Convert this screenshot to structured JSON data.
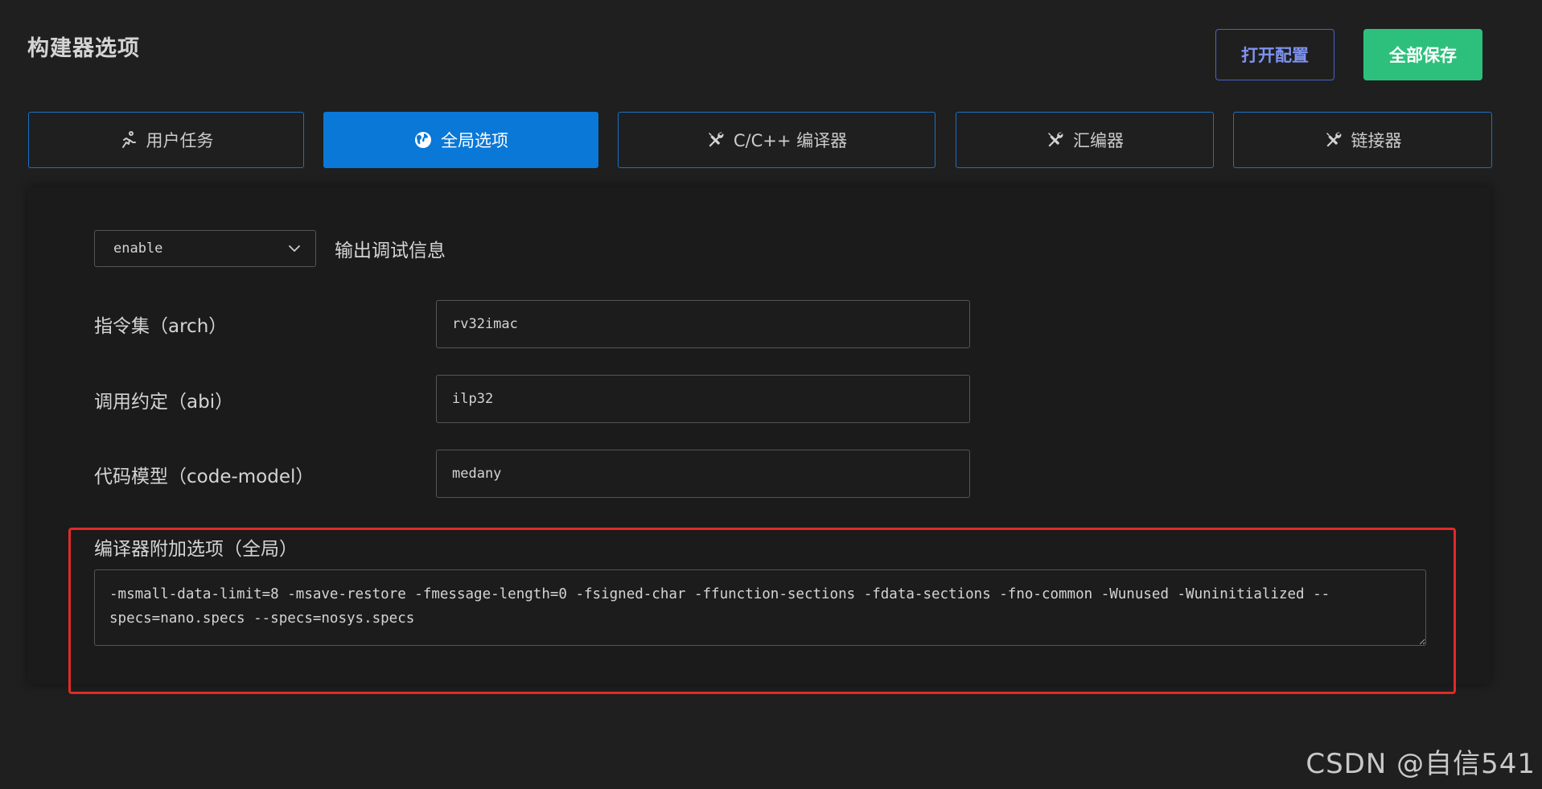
{
  "header": {
    "title": "构建器选项",
    "open_config_label": "打开配置",
    "save_all_label": "全部保存"
  },
  "tabs": [
    {
      "label": "用户任务",
      "icon": "run-icon",
      "active": false
    },
    {
      "label": "全局选项",
      "icon": "globe-icon",
      "active": true
    },
    {
      "label": "C/C++ 编译器",
      "icon": "tools-icon",
      "active": false
    },
    {
      "label": "汇编器",
      "icon": "tools-icon",
      "active": false
    },
    {
      "label": "链接器",
      "icon": "tools-icon",
      "active": false
    }
  ],
  "global_options": {
    "debug_select": {
      "value": "enable",
      "label": "输出调试信息"
    },
    "arch": {
      "label": "指令集（arch）",
      "value": "rv32imac"
    },
    "abi": {
      "label": "调用约定（abi）",
      "value": "ilp32"
    },
    "code_model": {
      "label": "代码模型（code-model）",
      "value": "medany"
    },
    "extra_options": {
      "label": "编译器附加选项（全局）",
      "value": "-msmall-data-limit=8 -msave-restore -fmessage-length=0 -fsigned-char -ffunction-sections -fdata-sections -fno-common -Wunused -Wuninitialized --specs=nano.specs --specs=nosys.specs"
    }
  },
  "watermark": "CSDN @自信541",
  "colors": {
    "background": "#1f1f1f",
    "tab_active": "#0a78d7",
    "tab_border": "#1d6fc4",
    "save_button": "#2dc07c",
    "open_button_text": "#7f93ef",
    "highlight": "#e12a27"
  }
}
